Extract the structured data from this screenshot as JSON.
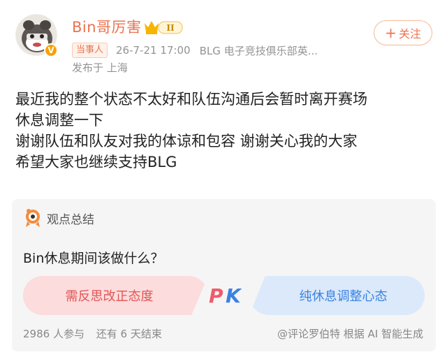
{
  "post": {
    "username": "Bin哥厉害",
    "level_badge": "II",
    "tag": "当事人",
    "timestamp": "26-7-21 17:00",
    "source": "BLG 电子竞技俱乐部英...",
    "location": "发布于 上海",
    "follow_label": "关注",
    "lines": [
      "最近我的整个状态不太好和队伍沟通后会暂时离开赛场",
      "休息调整一下",
      "谢谢队伍和队友对我的体谅和包容 谢谢关心我的大家",
      "希望大家也继续支持BLG"
    ]
  },
  "poll": {
    "title": "观点总结",
    "question": "Bin休息期间该做什么？",
    "option_a": "需反思改正态度",
    "option_b": "纯休息调整心态",
    "vs_label": "PK",
    "participants": "2986 人参与",
    "remaining": "还有 6 天结束",
    "source": "@评论罗伯特 根据 AI 智能生成"
  },
  "colors": {
    "accent": "#eb7350",
    "option_a": "#e25555",
    "option_b": "#3a82e0"
  },
  "icons": {
    "avatar": "cartoon-avatar",
    "verified": "verified-badge-icon",
    "summary": "robot-mascot-icon"
  }
}
